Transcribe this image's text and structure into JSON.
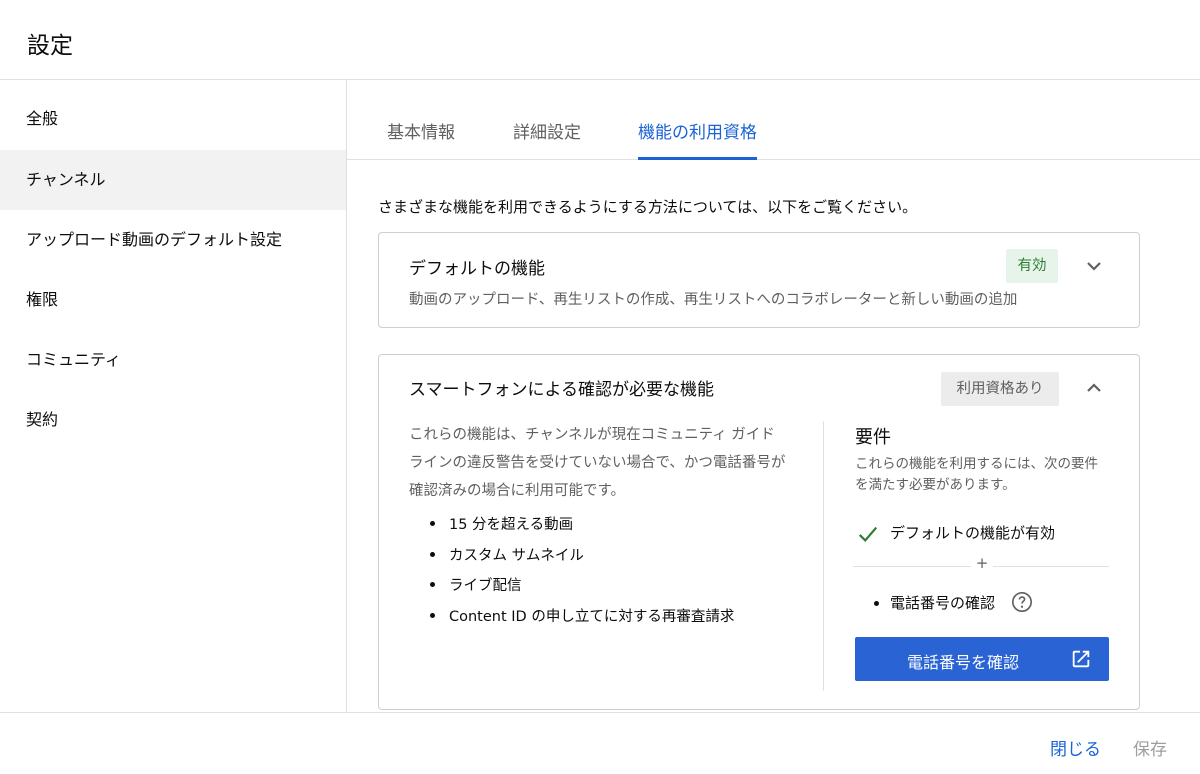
{
  "header": {
    "title": "設定"
  },
  "sidebar": {
    "items": [
      {
        "label": "全般"
      },
      {
        "label": "チャンネル"
      },
      {
        "label": "アップロード動画のデフォルト設定"
      },
      {
        "label": "権限"
      },
      {
        "label": "コミュニティ"
      },
      {
        "label": "契約"
      }
    ],
    "active_index": 1
  },
  "tabs": {
    "items": [
      {
        "label": "基本情報"
      },
      {
        "label": "詳細設定"
      },
      {
        "label": "機能の利用資格"
      }
    ],
    "active_index": 2
  },
  "content": {
    "intro": "さまざまな機能を利用できるようにする方法については、以下をご覧ください。",
    "default_features": {
      "title": "デフォルトの機能",
      "status": "有効",
      "description": "動画のアップロード、再生リストの作成、再生リストへのコラボレーターと新しい動画の追加"
    },
    "phone_features": {
      "title": "スマートフォンによる確認が必要な機能",
      "status": "利用資格あり",
      "description": "これらの機能は、チャンネルが現在コミュニティ ガイドラインの違反警告を受けていない場合で、かつ電話番号が確認済みの場合に利用可能です。",
      "list": [
        "15 分を超える動画",
        "カスタム サムネイル",
        "ライブ配信",
        "Content ID の申し立てに対する再審査請求"
      ],
      "requirements": {
        "title": "要件",
        "description": "これらの機能を利用するには、次の要件を満たす必要があります。",
        "met": "デフォルトの機能が有効",
        "plus": "+",
        "pending": "電話番号の確認",
        "verify_button": "電話番号を確認"
      }
    }
  },
  "footer": {
    "close_label": "閉じる",
    "save_label": "保存"
  },
  "colors": {
    "accent": "#1a63d6",
    "button": "#2a63d4",
    "enabled_badge_bg": "#e6f4ea",
    "enabled_badge_text": "#2e7d32",
    "eligible_badge_bg": "#ececec"
  }
}
